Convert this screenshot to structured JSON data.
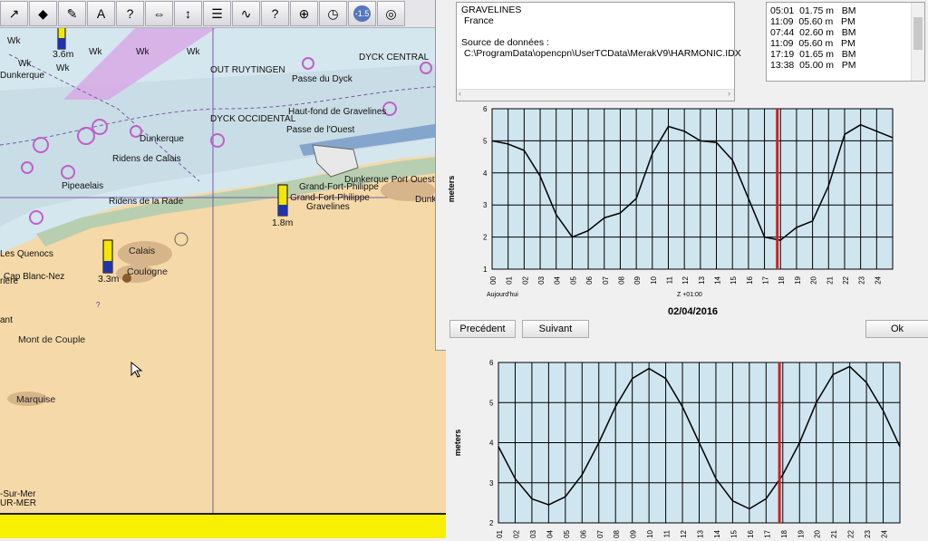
{
  "toolbar": {
    "icons": [
      "route-icon",
      "ais-icon",
      "measure-icon",
      "text-icon",
      "help-icon",
      "move-icon",
      "zoom-icon",
      "log-icon",
      "track-icon",
      "info-icon",
      "layers-icon",
      "tide-icon",
      "version-icon",
      "rescue-icon"
    ],
    "version_label": "-1.5"
  },
  "map": {
    "labels": [
      {
        "t": "Wk"
      },
      {
        "t": "Wk"
      },
      {
        "t": "Wk"
      },
      {
        "t": "Wk"
      },
      {
        "t": "Dunkerque"
      },
      {
        "t": "Wk"
      },
      {
        "t": "Wk"
      },
      {
        "t": "OUT RUYTINGEN"
      },
      {
        "t": "DYCK CENTRAL"
      },
      {
        "t": "Passe du Dyck"
      },
      {
        "t": "DYCK OCCIDENTAL"
      },
      {
        "t": "Haut-fond de Gravelines"
      },
      {
        "t": "Passe de l'Ouest"
      },
      {
        "t": "Ridens de Calais"
      },
      {
        "t": "Dunkerque"
      },
      {
        "t": "Pipeaelais"
      },
      {
        "t": "Ridens de la Rade"
      },
      {
        "t": "Grand-Fort-Philippe"
      },
      {
        "t": "Grand-Fort-Philippe"
      },
      {
        "t": "Gravelines"
      },
      {
        "t": "Dunkerque Port Ouest"
      },
      {
        "t": "Dunk"
      },
      {
        "t": "Les Quenocs"
      },
      {
        "t": "Cap Blanc-Nez"
      },
      {
        "t": "rière"
      },
      {
        "t": "Calais"
      },
      {
        "t": "Coulogne"
      },
      {
        "t": "ant"
      },
      {
        "t": "Mont de Couple"
      },
      {
        "t": "Marquise"
      },
      {
        "t": "-Sur-Mer"
      },
      {
        "t": "UR-MER"
      },
      {
        "t": "?"
      }
    ],
    "tide_markers": [
      "3.6m",
      "1.8m",
      "3.3m"
    ]
  },
  "dialog": {
    "station": "GRAVELINES",
    "country": "France",
    "source_label": "Source de données :",
    "source_path": "C:\\ProgramData\\opencpn\\UserTCData\\MerakV9\\HARMONIC.IDX",
    "tides": [
      "05:01  01.75 m   BM",
      "11:09  05.60 m   PM",
      "07:44  02.60 m   BM",
      "11:09  05.60 m   PM",
      "17:19  01.65 m   BM",
      "13:38  05.00 m   PM"
    ],
    "today_label": "Aujourd'hui",
    "tz_label": "Z +01:00",
    "date_label": "02/04/2016",
    "prev_button": "Precédent",
    "next_button": "Suivant",
    "ok_button": "Ok",
    "colors": {
      "chart_bg": "#cfe6f0",
      "now_line": "#cc2222"
    }
  },
  "chart_data": [
    {
      "type": "line",
      "ylabel": "meters",
      "ylim": [
        1,
        6
      ],
      "yticks": [
        "1",
        "2",
        "3",
        "4",
        "5",
        "6"
      ],
      "xticks": [
        "00",
        "01",
        "02",
        "03",
        "04",
        "05",
        "06",
        "07",
        "08",
        "09",
        "10",
        "11",
        "12",
        "13",
        "14",
        "15",
        "16",
        "17",
        "18",
        "19",
        "20",
        "21",
        "22",
        "23",
        "24"
      ],
      "x": [
        0,
        1,
        2,
        3,
        4,
        5,
        6,
        7,
        8,
        9,
        10,
        11,
        12,
        13,
        14,
        15,
        16,
        17,
        18,
        19,
        20,
        21,
        22,
        23,
        24,
        25
      ],
      "values": [
        5.0,
        4.9,
        4.7,
        3.9,
        2.7,
        2.0,
        2.2,
        2.6,
        2.75,
        3.2,
        4.6,
        5.45,
        5.3,
        5.0,
        4.95,
        4.4,
        3.2,
        2.0,
        1.9,
        2.3,
        2.5,
        3.6,
        5.2,
        5.5,
        5.3,
        5.1
      ],
      "now_x": 17.8
    },
    {
      "type": "line",
      "ylabel": "meters",
      "ylim": [
        2,
        6
      ],
      "yticks": [
        "2",
        "3",
        "4",
        "5",
        "6"
      ],
      "xticks": [
        "01",
        "02",
        "03",
        "04",
        "05",
        "06",
        "07",
        "08",
        "09",
        "10",
        "11",
        "12",
        "13",
        "14",
        "15",
        "16",
        "17",
        "18",
        "19",
        "20",
        "21",
        "22",
        "23",
        "24"
      ],
      "x": [
        0,
        1,
        2,
        3,
        4,
        5,
        6,
        7,
        8,
        9,
        10,
        11,
        12,
        13,
        14,
        15,
        16,
        17,
        18,
        19,
        20,
        21,
        22,
        23,
        24
      ],
      "values": [
        3.9,
        3.1,
        2.6,
        2.45,
        2.65,
        3.2,
        4.0,
        4.9,
        5.6,
        5.85,
        5.6,
        4.9,
        4.0,
        3.1,
        2.55,
        2.35,
        2.6,
        3.2,
        4.0,
        5.0,
        5.7,
        5.9,
        5.5,
        4.8,
        3.9
      ],
      "now_x": 16.8
    }
  ]
}
